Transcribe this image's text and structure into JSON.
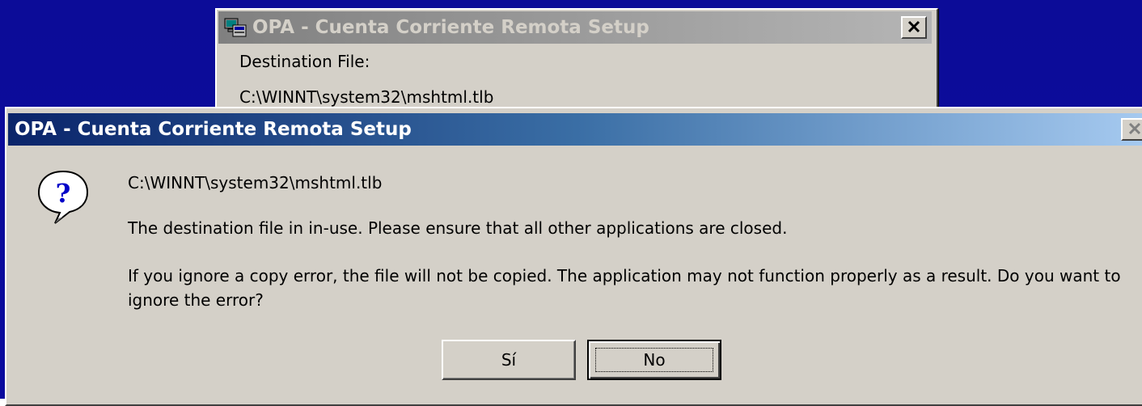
{
  "back_window": {
    "title": "OPA - Cuenta Corriente Remota Setup",
    "destination_label": "Destination File:",
    "destination_path": "C:\\WINNT\\system32\\mshtml.tlb",
    "icons": {
      "app": "setup-computer-icon",
      "close": "close-icon"
    }
  },
  "dialog": {
    "title": "OPA - Cuenta Corriente Remota Setup",
    "icon": "question-icon",
    "path": "C:\\WINNT\\system32\\mshtml.tlb",
    "line1": "The destination file in in-use.  Please ensure that all other applications are closed.",
    "line2": "If you ignore a copy error, the file will not be copied.  The application may not function properly as a result.  Do you want to ignore the error?",
    "buttons": {
      "yes": "Sí",
      "no": "No"
    },
    "default_button": "no"
  },
  "colors": {
    "desktop": "#0a0a9a",
    "face": "#d4d0c8",
    "active_title_start": "#0a246a",
    "active_title_end": "#a6caf0",
    "inactive_title_start": "#808080",
    "inactive_title_end": "#b5b5b5"
  }
}
